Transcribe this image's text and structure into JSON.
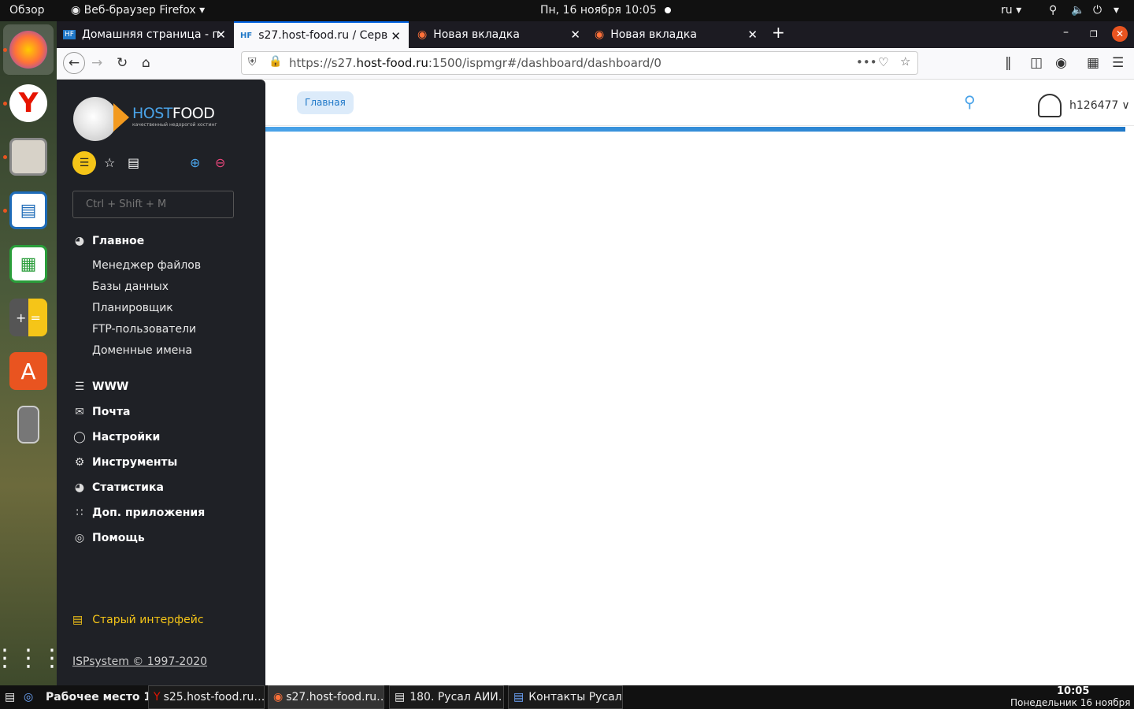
{
  "topbar": {
    "activities": "Обзор",
    "app_menu": "Веб-браузер Firefox ▾",
    "clock": "Пн, 16 ноября  10:05",
    "lang": "ru ▾"
  },
  "dock": {
    "items": [
      "firefox-icon",
      "yandex-browser-icon",
      "files-icon",
      "writer-icon",
      "calc-icon",
      "calculator-icon",
      "software-icon",
      "device-icon",
      "app-grid-icon"
    ]
  },
  "browser": {
    "tabs": [
      {
        "label": "Домашняя страница - п",
        "favicon": "HF"
      },
      {
        "label": "s27.host-food.ru / Серве",
        "favicon": "HF"
      },
      {
        "label": "Новая вкладка",
        "favicon": "ff"
      },
      {
        "label": "Новая вкладка",
        "favicon": "ff"
      }
    ],
    "url_prefix": "https://s27.",
    "url_domain": "host-food.ru",
    "url_suffix": ":1500/ispmgr#/dashboard/dashboard/0",
    "accent": "#0060df"
  },
  "sidebar": {
    "logo_host": "HOST",
    "logo_food": "FOOD",
    "logo_sub": "качественный недорогой хостинг",
    "search_placeholder": "Ctrl + Shift + M",
    "sections": [
      {
        "label": "Главное",
        "icon": "globe-icon"
      },
      {
        "label": "WWW",
        "icon": "sliders-icon"
      },
      {
        "label": "Почта",
        "icon": "mail-icon"
      },
      {
        "label": "Настройки",
        "icon": "settings-icon"
      },
      {
        "label": "Инструменты",
        "icon": "gear-icon"
      },
      {
        "label": "Статистика",
        "icon": "pie-icon"
      },
      {
        "label": "Доп. приложения",
        "icon": "apps-icon"
      },
      {
        "label": "Помощь",
        "icon": "help-icon"
      }
    ],
    "subitems": [
      "Менеджер файлов",
      "Базы данных",
      "Планировщик",
      "FTP-пользователи",
      "Доменные имена"
    ],
    "old_ui": "Старый интерфейс",
    "copyright": "ISPsystem © 1997-2020",
    "accent_yellow": "#f5c518"
  },
  "main": {
    "breadcrumb": "Главная",
    "username": "h126477"
  },
  "taskbar": {
    "workspace": "Рабочее место 1",
    "windows": [
      "s25.host-food.ru…",
      "s27.host-food.ru…",
      "180. Русал АИИ…",
      "Контакты Русал …"
    ],
    "time": "10:05",
    "date": "Понедельник 16 ноября"
  }
}
